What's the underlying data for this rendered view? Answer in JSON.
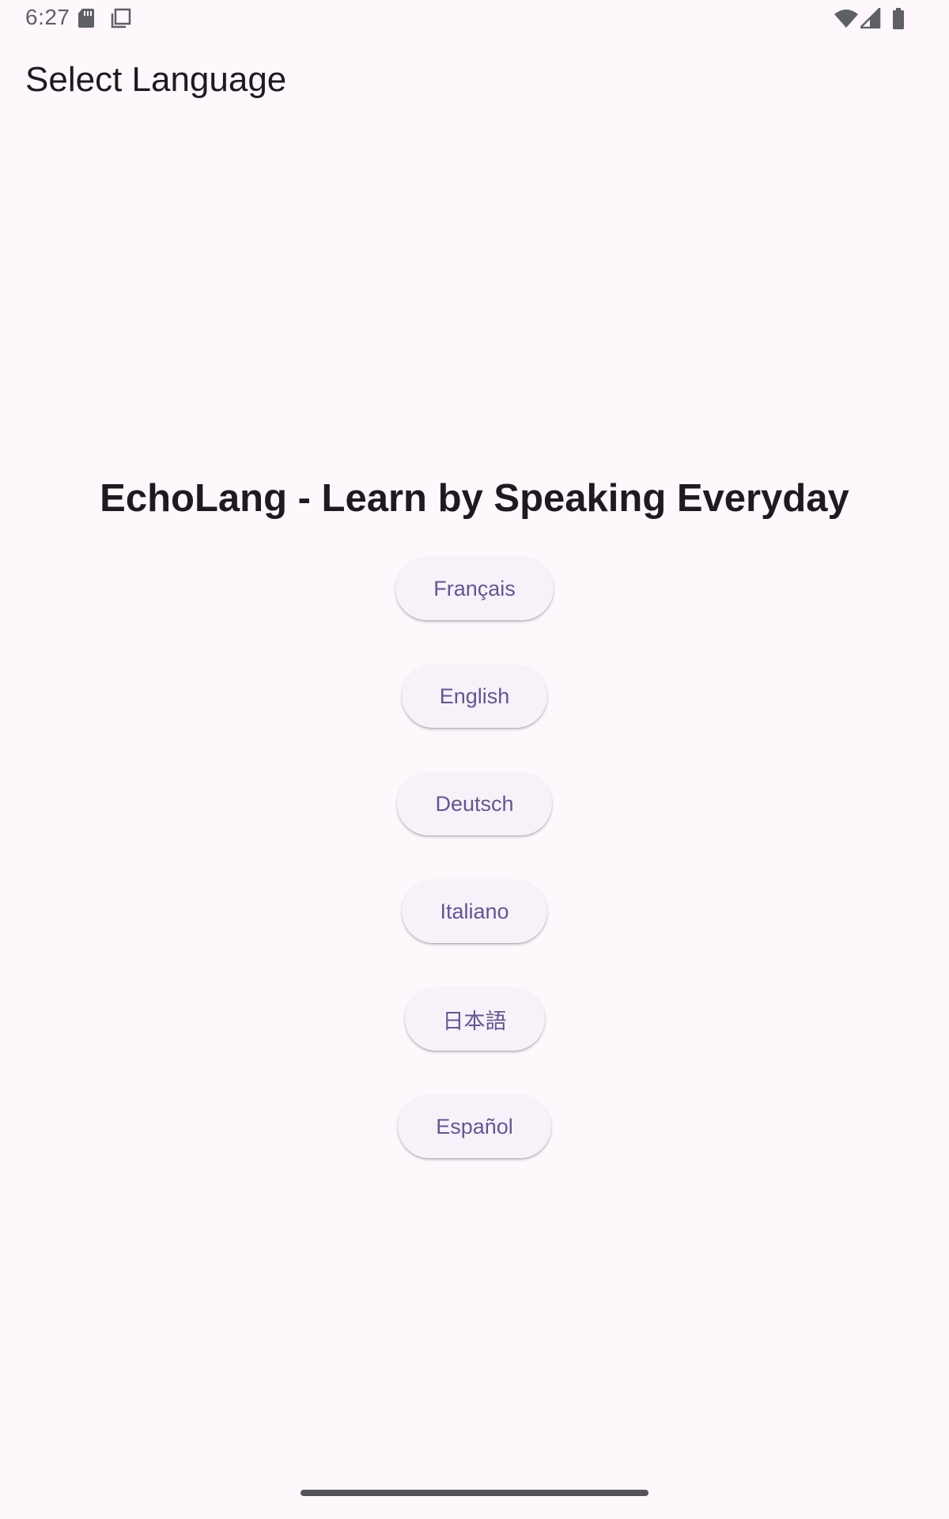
{
  "status_bar": {
    "time": "6:27",
    "icons": [
      "sd-card-icon",
      "screenshot-icon",
      "wifi-icon",
      "signal-icon",
      "battery-icon"
    ]
  },
  "app_bar": {
    "title": "Select Language"
  },
  "main": {
    "headline": "EchoLang - Learn by Speaking Everyday",
    "languages": [
      {
        "label": "Français"
      },
      {
        "label": "English"
      },
      {
        "label": "Deutsch"
      },
      {
        "label": "Italiano"
      },
      {
        "label": "日本語"
      },
      {
        "label": "Español"
      }
    ]
  },
  "colors": {
    "background": "#FEF7FC",
    "button_background": "#F7F2FA",
    "button_text": "#65558F",
    "text_primary": "#1D1B20"
  }
}
